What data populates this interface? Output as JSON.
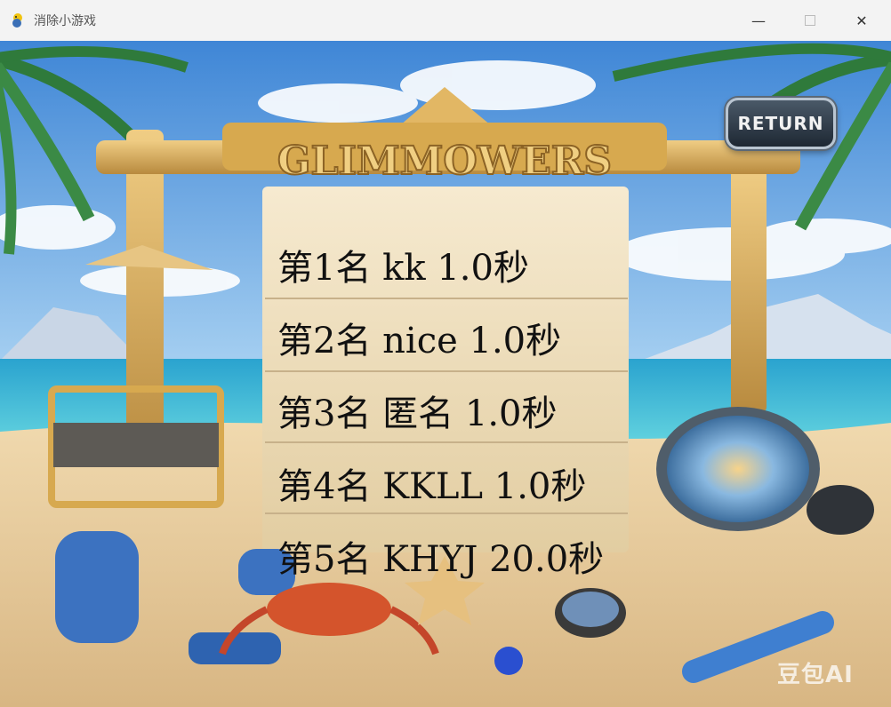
{
  "window": {
    "title": "消除小游戏",
    "app_icon": "pygame-snake-icon",
    "controls": [
      "minimize-icon",
      "maximize-icon",
      "close-icon"
    ]
  },
  "game": {
    "sign_title": "GLIMMOWERS",
    "return_label": "RETURN",
    "leaderboard": [
      {
        "text": "第1名 kk 1.0秒"
      },
      {
        "text": "第2名 nice 1.0秒"
      },
      {
        "text": "第3名 匿名 1.0秒"
      },
      {
        "text": "第4名 KKLL 1.0秒"
      },
      {
        "text": "第5名 KHYJ 20.0秒"
      }
    ],
    "watermark": "豆包AI"
  },
  "colors": {
    "sky": "#5d9ee0",
    "sea": "#2fb0d2",
    "sand": "#e6c99a",
    "wood": "#d9b36a",
    "parchment": "#efe2c4"
  }
}
